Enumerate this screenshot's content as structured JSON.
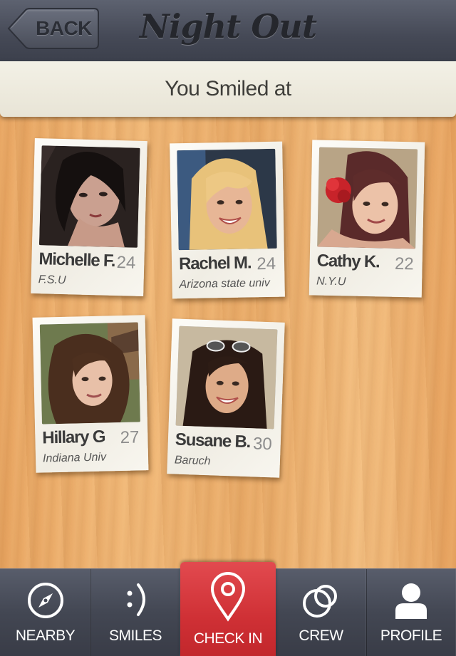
{
  "header": {
    "back_label": "BACK",
    "title": "Night Out"
  },
  "subheader": {
    "title": "You Smiled at"
  },
  "profiles": [
    {
      "name": "Michelle F.",
      "age": "24",
      "school": "F.S.U"
    },
    {
      "name": "Rachel M.",
      "age": "24",
      "school": "Arizona state univ"
    },
    {
      "name": "Cathy K.",
      "age": "22",
      "school": "N.Y.U"
    },
    {
      "name": "Hillary G",
      "age": "27",
      "school": "Indiana Univ"
    },
    {
      "name": "Susane B.",
      "age": "30",
      "school": "Baruch"
    }
  ],
  "tabs": [
    {
      "label": "NEARBY",
      "icon": "compass-icon"
    },
    {
      "label": "SMILES",
      "icon": "smiley-icon"
    },
    {
      "label": "CHECK IN",
      "icon": "map-pin-icon",
      "active": true
    },
    {
      "label": "CREW",
      "icon": "rings-icon"
    },
    {
      "label": "PROFILE",
      "icon": "person-icon"
    }
  ],
  "colors": {
    "active_tab": "#cf3035",
    "bar": "#454956",
    "wood": "#f1b877"
  }
}
